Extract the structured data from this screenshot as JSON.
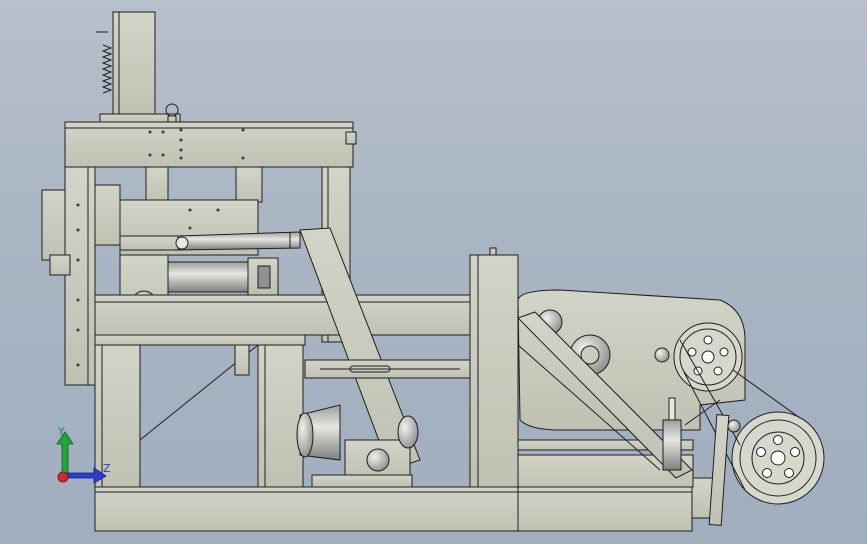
{
  "viewport": {
    "background_top": "#b7c0cb",
    "background_bottom": "#a0aebe"
  },
  "model": {
    "description": "",
    "frame_color": "#c9cbbd",
    "edge_color": "#1e1e1e",
    "detail_color": "#8f9290"
  },
  "triad": {
    "y_label": "Y",
    "z_label": "Z",
    "y_color": "#22a83a",
    "z_color": "#2a3fd0",
    "origin_color": "#d12a2a"
  }
}
